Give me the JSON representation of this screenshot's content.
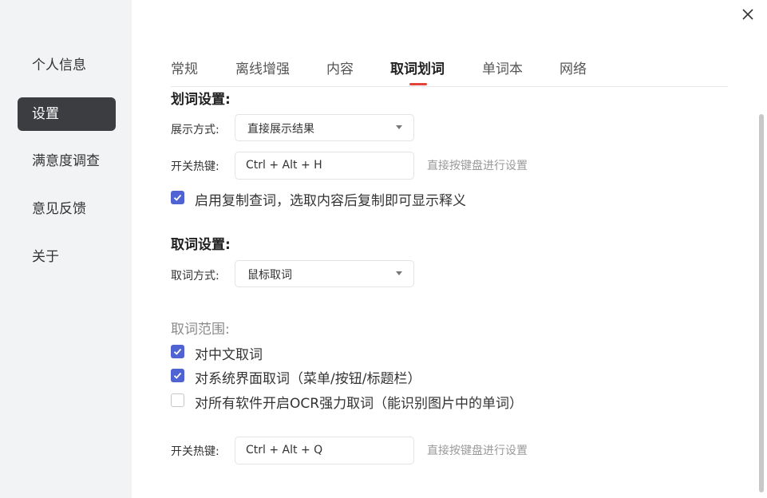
{
  "sidebar": {
    "items": [
      {
        "label": "个人信息"
      },
      {
        "label": "设置"
      },
      {
        "label": "满意度调查"
      },
      {
        "label": "意见反馈"
      },
      {
        "label": "关于"
      }
    ]
  },
  "tabs": [
    {
      "label": "常规"
    },
    {
      "label": "离线增强"
    },
    {
      "label": "内容"
    },
    {
      "label": "取词划词"
    },
    {
      "label": "单词本"
    },
    {
      "label": "网络"
    }
  ],
  "highlight": {
    "title": "划词设置:",
    "display_label": "展示方式:",
    "display_value": "直接展示结果",
    "hotkey_label": "开关热键:",
    "hotkey_value": "Ctrl + Alt + H",
    "hotkey_hint": "直接按键盘进行设置",
    "copy_lookup": {
      "label": "启用复制查词，选取内容后复制即可显示释义",
      "checked": true
    }
  },
  "capture": {
    "title": "取词设置:",
    "method_label": "取词方式:",
    "method_value": "鼠标取词",
    "range_label": "取词范围:",
    "options": [
      {
        "label": "对中文取词",
        "checked": true
      },
      {
        "label": "对系统界面取词（菜单/按钮/标题栏）",
        "checked": true
      },
      {
        "label": "对所有软件开启OCR强力取词（能识别图片中的单词）",
        "checked": false
      }
    ],
    "hotkey_label": "开关热键:",
    "hotkey_value": "Ctrl + Alt + Q",
    "hotkey_hint": "直接按键盘进行设置"
  },
  "colors": {
    "accent_checkbox": "#4f63d2",
    "tab_underline": "#e0443a",
    "sidebar_active": "#3c3d41"
  }
}
